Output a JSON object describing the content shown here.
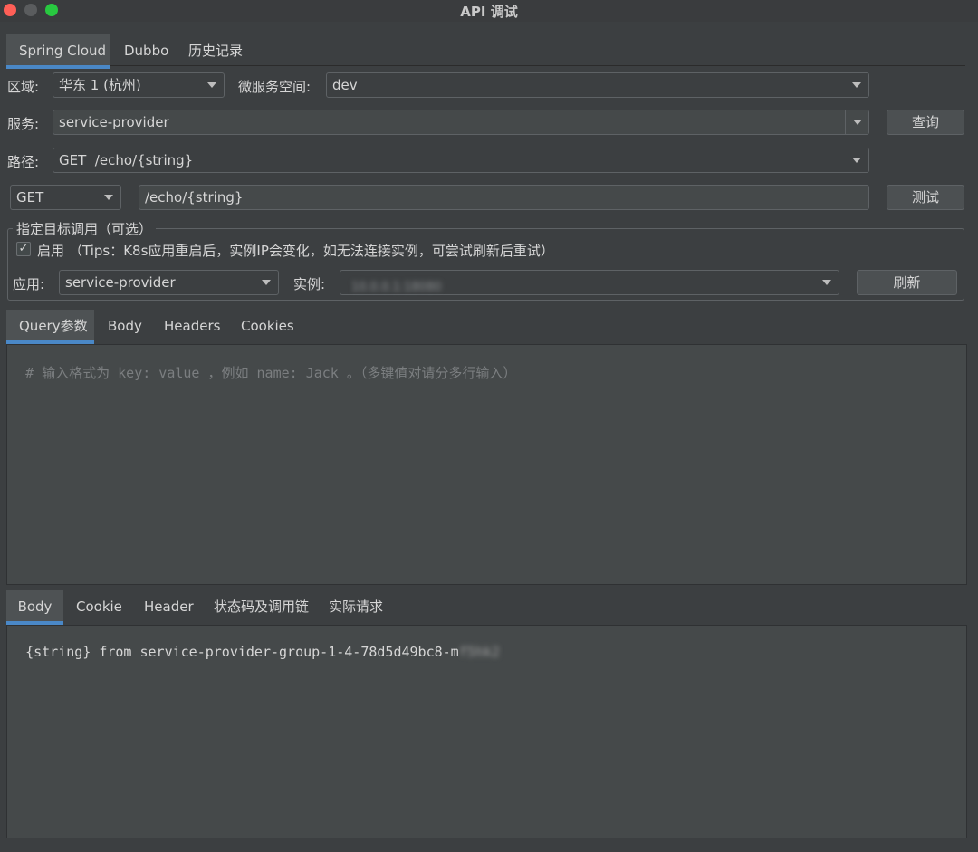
{
  "window": {
    "title": "API 调试"
  },
  "top_tabs": [
    {
      "label": "Spring Cloud",
      "active": true
    },
    {
      "label": "Dubbo",
      "active": false
    },
    {
      "label": "历史记录",
      "active": false
    }
  ],
  "form": {
    "region_label": "区域:",
    "region_value": "华东 1 (杭州)",
    "namespace_label": "微服务空间:",
    "namespace_value": "dev",
    "service_label": "服务:",
    "service_value": "service-provider",
    "query_button": "查询",
    "path_label": "路径:",
    "path_value": "GET  /echo/{string}",
    "method_value": "GET",
    "url_value": "/echo/{string}",
    "test_button": "测试"
  },
  "target": {
    "group_title": "指定目标调用（可选）",
    "enable_checked": true,
    "enable_label": "启用",
    "tips": "（Tips：K8s应用重启后，实例IP会变化，如无法连接实例，可尝试刷新后重试）",
    "app_label": "应用:",
    "app_value": "service-provider",
    "instance_label": "实例:",
    "instance_value": "10.0.0.1:18080",
    "refresh_button": "刷新"
  },
  "request_tabs": [
    {
      "label": "Query参数",
      "active": true
    },
    {
      "label": "Body",
      "active": false
    },
    {
      "label": "Headers",
      "active": false
    },
    {
      "label": "Cookies",
      "active": false
    }
  ],
  "request_editor": {
    "placeholder": "# 输入格式为 key: value ，例如 name: Jack 。（多键值对请分多行输入）"
  },
  "response_tabs": [
    {
      "label": "Body",
      "active": true
    },
    {
      "label": "Cookie",
      "active": false
    },
    {
      "label": "Header",
      "active": false
    },
    {
      "label": "状态码及调用链",
      "active": false
    },
    {
      "label": "实际请求",
      "active": false
    }
  ],
  "response": {
    "body_text": "{string} from service-provider-group-1-4-78d5d49bc8-m",
    "body_blurred_suffix": "f5hk2"
  },
  "colors": {
    "background": "#3c3f41",
    "accent": "#4a88c7",
    "field": "#45494a"
  }
}
